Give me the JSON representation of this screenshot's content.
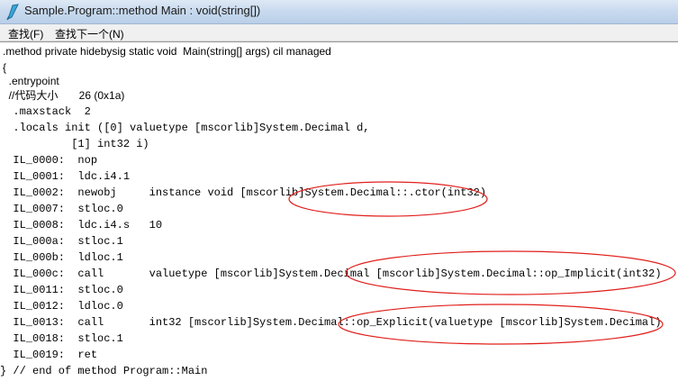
{
  "window": {
    "title": "Sample.Program::method Main : void(string[])"
  },
  "menu": {
    "find": "查找(F)",
    "find_next": "查找下一个(N)"
  },
  "code_lines": [
    ".method private hidebysig static void  Main(string[] args) cil managed",
    "{",
    "  .entrypoint",
    "  //代码大小       26 (0x1a)",
    "  .maxstack  2",
    "  .locals init ([0] valuetype [mscorlib]System.Decimal d,",
    "           [1] int32 i)",
    "  IL_0000:  nop",
    "  IL_0001:  ldc.i4.1",
    "  IL_0002:  newobj     instance void [mscorlib]System.Decimal::.ctor(int32)",
    "  IL_0007:  stloc.0",
    "  IL_0008:  ldc.i4.s   10",
    "  IL_000a:  stloc.1",
    "  IL_000b:  ldloc.1",
    "  IL_000c:  call       valuetype [mscorlib]System.Decimal [mscorlib]System.Decimal::op_Implicit(int32)",
    "  IL_0011:  stloc.0",
    "  IL_0012:  ldloc.0",
    "  IL_0013:  call       int32 [mscorlib]System.Decimal::op_Explicit(valuetype [mscorlib]System.Decimal)",
    "  IL_0018:  stloc.1",
    "  IL_0019:  ret",
    "} // end of method Program::Main"
  ],
  "annotation_color": "#e0201c"
}
